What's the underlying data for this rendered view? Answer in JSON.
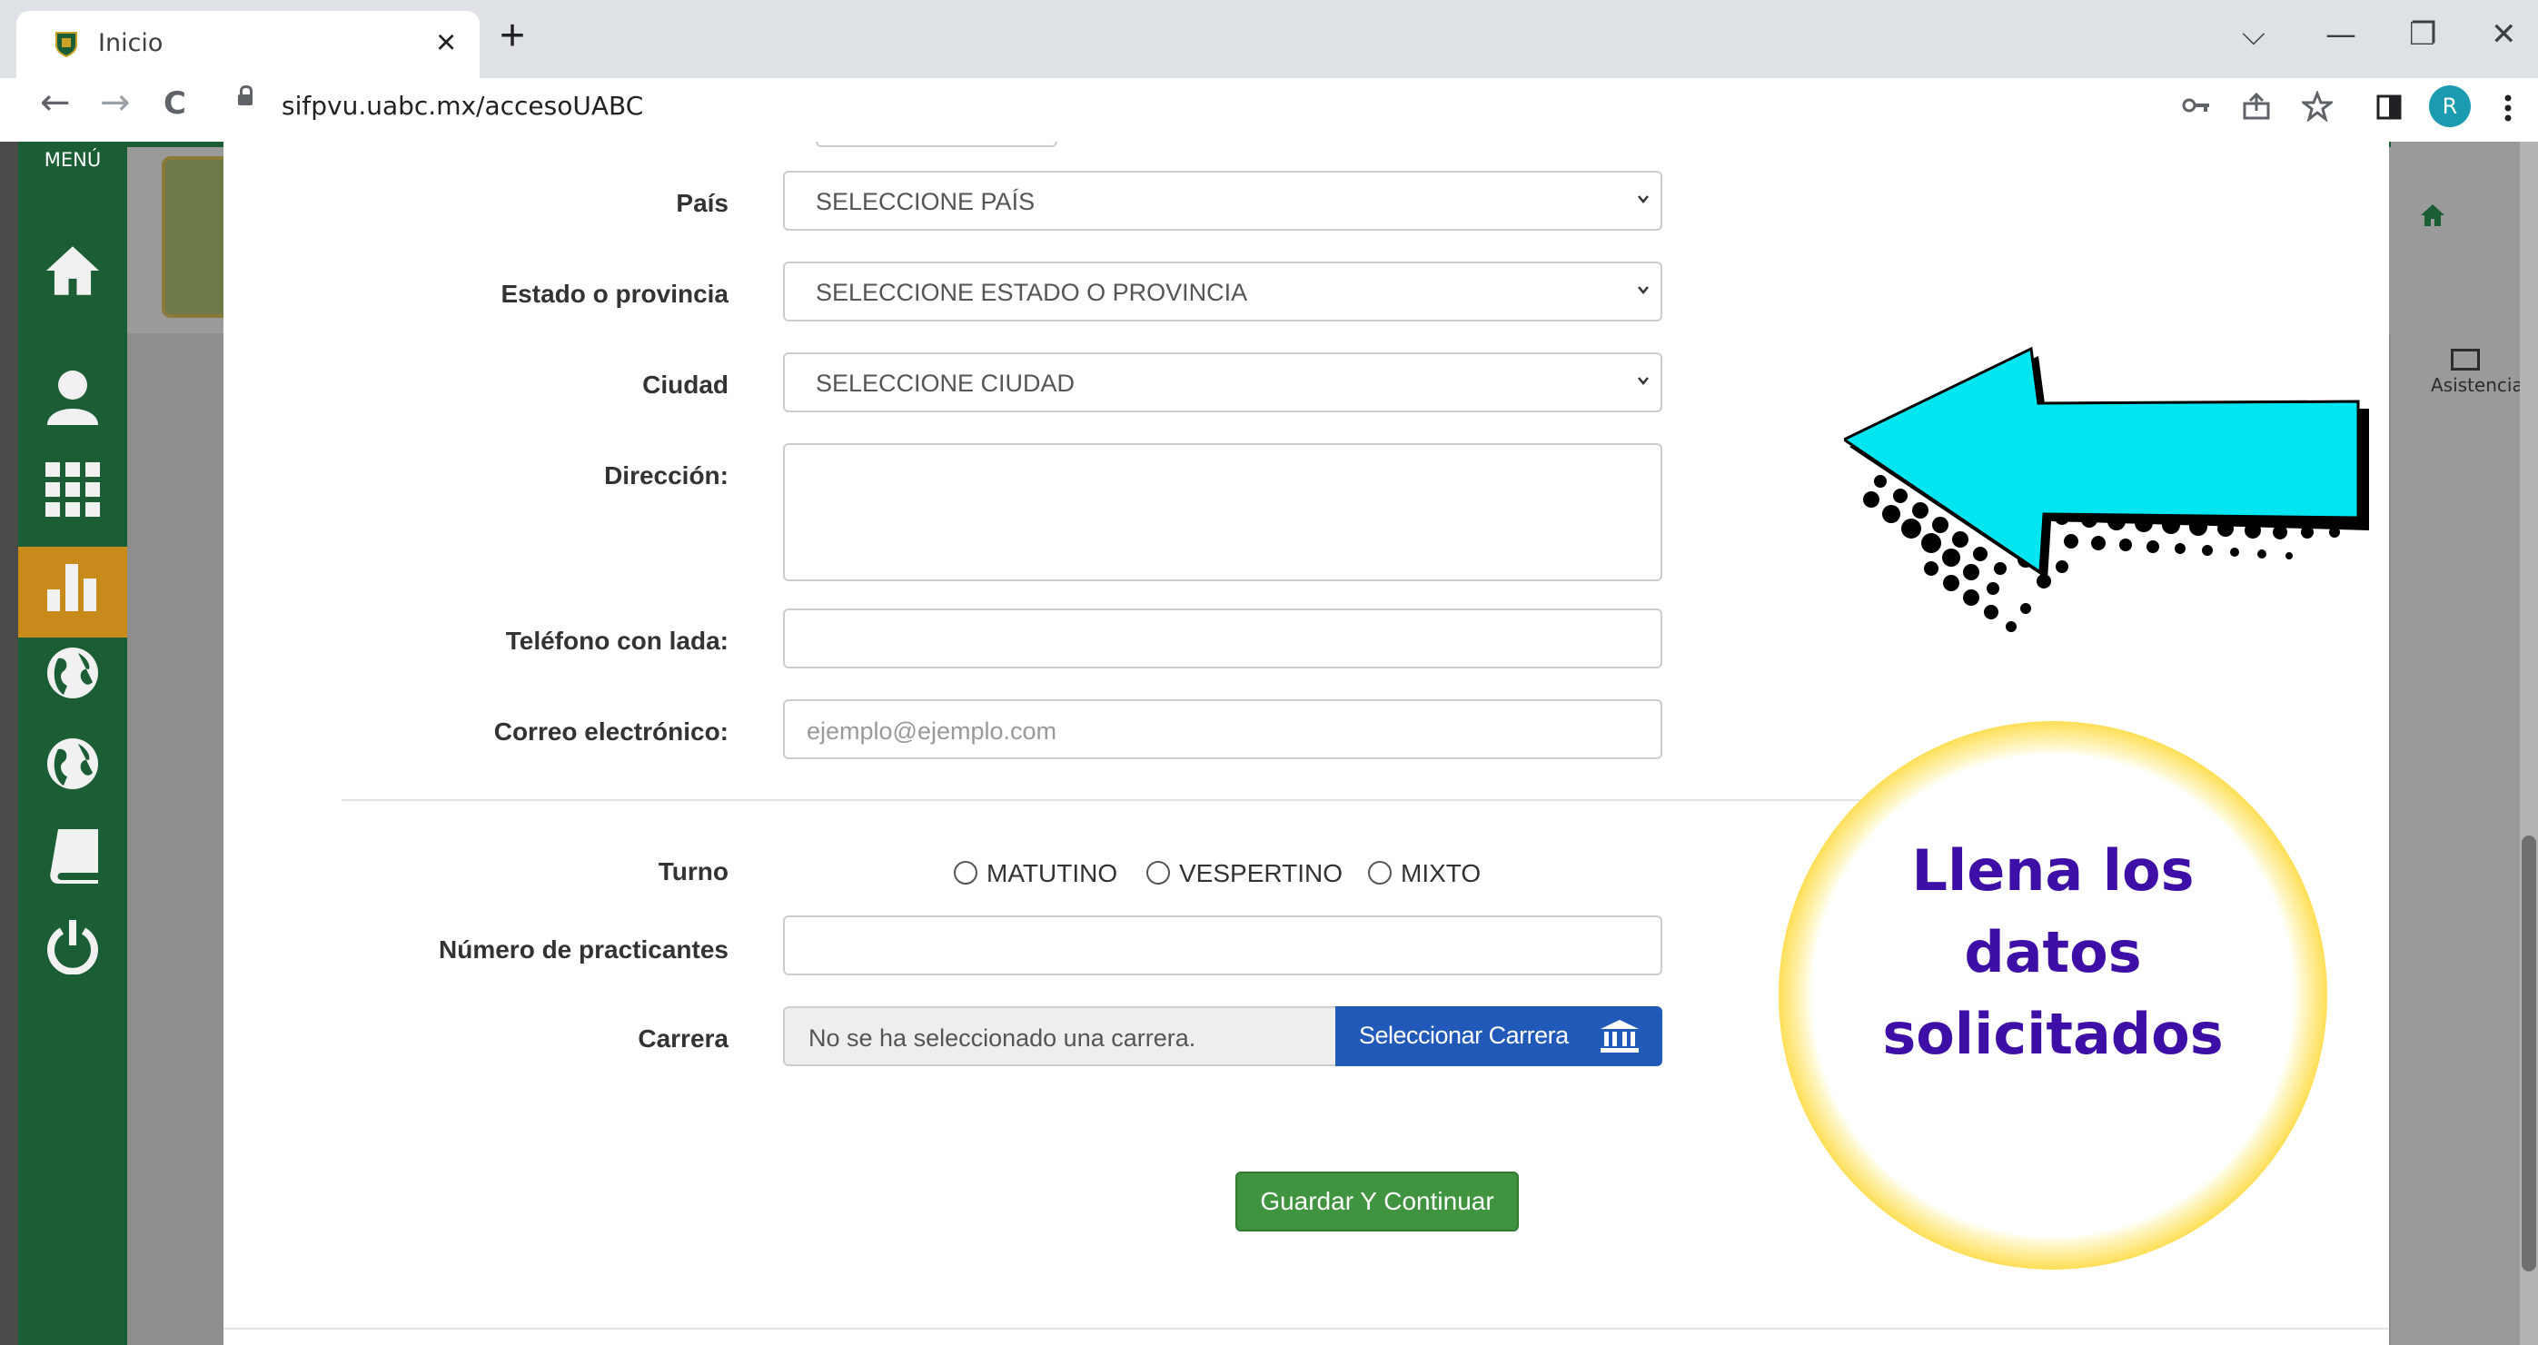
{
  "browser": {
    "tab_title": "Inicio",
    "tab_close": "×",
    "new_tab": "+",
    "url": "sifpvu.uabc.mx/accesoUABC",
    "profile_initial": "R",
    "window_controls": {
      "dropdown": "⌵",
      "minimize": "—",
      "restore": "❐",
      "close": "✕"
    },
    "nav": {
      "back": "←",
      "forward": "→",
      "reload": "C"
    }
  },
  "sidebar": {
    "menu_label": "MENÚ",
    "items": [
      {
        "icon": "home-icon"
      },
      {
        "icon": "user-icon"
      },
      {
        "icon": "grid-icon"
      },
      {
        "icon": "bar-chart-icon",
        "active": true
      },
      {
        "icon": "globe-icon"
      },
      {
        "icon": "globe-icon"
      },
      {
        "icon": "book-icon"
      },
      {
        "icon": "power-icon"
      }
    ]
  },
  "right_panel": {
    "asistencia_label": "Asistencia"
  },
  "form": {
    "pais": {
      "label": "País",
      "value": "SELECCIONE PAÍS"
    },
    "estado": {
      "label": "Estado o provincia",
      "value": "SELECCIONE ESTADO O PROVINCIA"
    },
    "ciudad": {
      "label": "Ciudad",
      "value": "SELECCIONE CIUDAD"
    },
    "direccion": {
      "label": "Dirección:",
      "value": ""
    },
    "telefono": {
      "label": "Teléfono con lada:",
      "value": ""
    },
    "correo": {
      "label": "Correo electrónico:",
      "placeholder": "ejemplo@ejemplo.com"
    },
    "turno": {
      "label": "Turno",
      "options": [
        "MATUTINO",
        "VESPERTINO",
        "MIXTO"
      ]
    },
    "practicantes": {
      "label": "Número de practicantes",
      "value": ""
    },
    "carrera": {
      "label": "Carrera",
      "value": "No se ha seleccionado una carrera.",
      "button_label": "Seleccionar Carrera"
    },
    "save_button": "Guardar Y Continuar"
  },
  "annotation": {
    "callout_lines": [
      "Llena los",
      "datos",
      "solicitados"
    ],
    "arrow_color": "#00e5f0",
    "ring_color": "#ffd21a",
    "text_color": "#3d0fa6"
  }
}
